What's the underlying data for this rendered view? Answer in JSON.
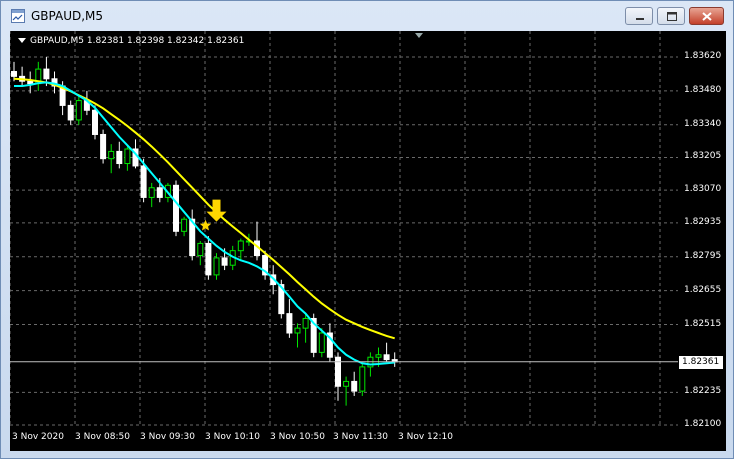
{
  "window": {
    "title": "GBPAUD,M5"
  },
  "chart_header": {
    "text": "GBPAUD,M5  1.82381 1.82398 1.82342 1.82361"
  },
  "price_axis": {
    "labels": [
      "1.83620",
      "1.83480",
      "1.83340",
      "1.83205",
      "1.83070",
      "1.82935",
      "1.82795",
      "1.82655",
      "1.82515",
      "1.82235",
      "1.82100"
    ],
    "values": [
      1.8362,
      1.8348,
      1.8334,
      1.83205,
      1.8307,
      1.82935,
      1.82795,
      1.82655,
      1.82515,
      1.82235,
      1.821
    ],
    "current_price": "1.82361"
  },
  "time_axis": {
    "labels": [
      "3 Nov 2020",
      "3 Nov 08:50",
      "3 Nov 09:30",
      "3 Nov 10:10",
      "3 Nov 10:50",
      "3 Nov 11:30",
      "3 Nov 12:10"
    ]
  },
  "colors": {
    "background": "#000000",
    "grid": "#6a6a6a",
    "bull": "#00e600",
    "bear": "#ffffff",
    "ma_fast": "#00ffff",
    "ma_slow": "#ffff00",
    "arrow": "#ffd700"
  },
  "icons": {
    "arrow": "down-arrow-signal-icon",
    "star": "star-signal-icon"
  },
  "chart_data": {
    "type": "candlestick",
    "symbol": "GBPAUD",
    "timeframe": "M5",
    "ylim": [
      1.821,
      1.8362
    ],
    "candles": [
      [
        1.8356,
        1.836,
        1.8352,
        1.8354
      ],
      [
        1.8354,
        1.8358,
        1.835,
        1.8352
      ],
      [
        1.8352,
        1.8356,
        1.8347,
        1.8351
      ],
      [
        1.8351,
        1.836,
        1.8348,
        1.8357
      ],
      [
        1.8357,
        1.8362,
        1.835,
        1.8353
      ],
      [
        1.8353,
        1.8356,
        1.8347,
        1.835
      ],
      [
        1.835,
        1.8352,
        1.8338,
        1.8342
      ],
      [
        1.8342,
        1.8344,
        1.8334,
        1.8336
      ],
      [
        1.8336,
        1.8346,
        1.8334,
        1.8344
      ],
      [
        1.8344,
        1.8348,
        1.8338,
        1.834
      ],
      [
        1.834,
        1.8342,
        1.8328,
        1.833
      ],
      [
        1.833,
        1.8332,
        1.8318,
        1.832
      ],
      [
        1.832,
        1.8326,
        1.8314,
        1.8323
      ],
      [
        1.8323,
        1.8327,
        1.8316,
        1.8318
      ],
      [
        1.8318,
        1.8325,
        1.8315,
        1.8324
      ],
      [
        1.8324,
        1.8328,
        1.8316,
        1.8317
      ],
      [
        1.8317,
        1.832,
        1.8302,
        1.8304
      ],
      [
        1.8304,
        1.831,
        1.83,
        1.8308
      ],
      [
        1.8308,
        1.8312,
        1.8302,
        1.8304
      ],
      [
        1.8304,
        1.831,
        1.8302,
        1.8309
      ],
      [
        1.8309,
        1.8311,
        1.8288,
        1.829
      ],
      [
        1.829,
        1.8296,
        1.8288,
        1.8295
      ],
      [
        1.8295,
        1.8299,
        1.8278,
        1.828
      ],
      [
        1.828,
        1.8286,
        1.8276,
        1.8285
      ],
      [
        1.8285,
        1.8288,
        1.827,
        1.8272
      ],
      [
        1.8272,
        1.8281,
        1.827,
        1.8279
      ],
      [
        1.8279,
        1.8283,
        1.8274,
        1.8276
      ],
      [
        1.8276,
        1.8284,
        1.8274,
        1.8282
      ],
      [
        1.8282,
        1.8287,
        1.8278,
        1.8286
      ],
      [
        1.8286,
        1.8289,
        1.8284,
        1.8286
      ],
      [
        1.8286,
        1.8294,
        1.8278,
        1.828
      ],
      [
        1.828,
        1.8282,
        1.827,
        1.8272
      ],
      [
        1.8272,
        1.8276,
        1.8264,
        1.8268
      ],
      [
        1.8268,
        1.827,
        1.8254,
        1.8256
      ],
      [
        1.8256,
        1.8262,
        1.8246,
        1.8248
      ],
      [
        1.8248,
        1.8252,
        1.8242,
        1.825
      ],
      [
        1.825,
        1.8256,
        1.8244,
        1.8254
      ],
      [
        1.8254,
        1.8256,
        1.8238,
        1.824
      ],
      [
        1.824,
        1.825,
        1.8238,
        1.8248
      ],
      [
        1.8248,
        1.8252,
        1.8236,
        1.8238
      ],
      [
        1.8238,
        1.824,
        1.822,
        1.8226
      ],
      [
        1.8226,
        1.823,
        1.8218,
        1.8228
      ],
      [
        1.8228,
        1.8232,
        1.8222,
        1.8224
      ],
      [
        1.8224,
        1.8236,
        1.8222,
        1.8234
      ],
      [
        1.8234,
        1.824,
        1.823,
        1.8238
      ],
      [
        1.8238,
        1.8242,
        1.8234,
        1.8239
      ],
      [
        1.8239,
        1.8244,
        1.8236,
        1.8237
      ],
      [
        1.8237,
        1.824,
        1.8234,
        1.82361
      ]
    ],
    "ma_fast": [
      1.835,
      1.835,
      1.83505,
      1.83512,
      1.83515,
      1.8351,
      1.835,
      1.8348,
      1.8346,
      1.8344,
      1.8341,
      1.8337,
      1.8333,
      1.8329,
      1.83255,
      1.8322,
      1.8318,
      1.8314,
      1.831,
      1.8306,
      1.8302,
      1.8298,
      1.8294,
      1.829,
      1.8287,
      1.8284,
      1.82815,
      1.82795,
      1.8278,
      1.8277,
      1.82755,
      1.82735,
      1.82705,
      1.8267,
      1.8263,
      1.8259,
      1.8256,
      1.8252,
      1.8249,
      1.8246,
      1.8242,
      1.8239,
      1.8237,
      1.82355,
      1.8235,
      1.82352,
      1.82355,
      1.82358
    ],
    "ma_slow": [
      1.8353,
      1.83528,
      1.83525,
      1.8352,
      1.83515,
      1.83505,
      1.83492,
      1.83478,
      1.83462,
      1.83446,
      1.83428,
      1.83408,
      1.83384,
      1.8336,
      1.83335,
      1.83308,
      1.8328,
      1.8325,
      1.83218,
      1.83185,
      1.8315,
      1.83115,
      1.8308,
      1.83045,
      1.8301,
      1.82978,
      1.82948,
      1.8292,
      1.82893,
      1.82865,
      1.82838,
      1.8281,
      1.82782,
      1.82752,
      1.82722,
      1.8269,
      1.8266,
      1.8263,
      1.82602,
      1.82578,
      1.82555,
      1.82535,
      1.8252,
      1.82505,
      1.82492,
      1.8248,
      1.82468,
      1.82458
    ],
    "signal": {
      "type": "arrow-down",
      "candle_index": 25,
      "price": 1.8294
    }
  }
}
